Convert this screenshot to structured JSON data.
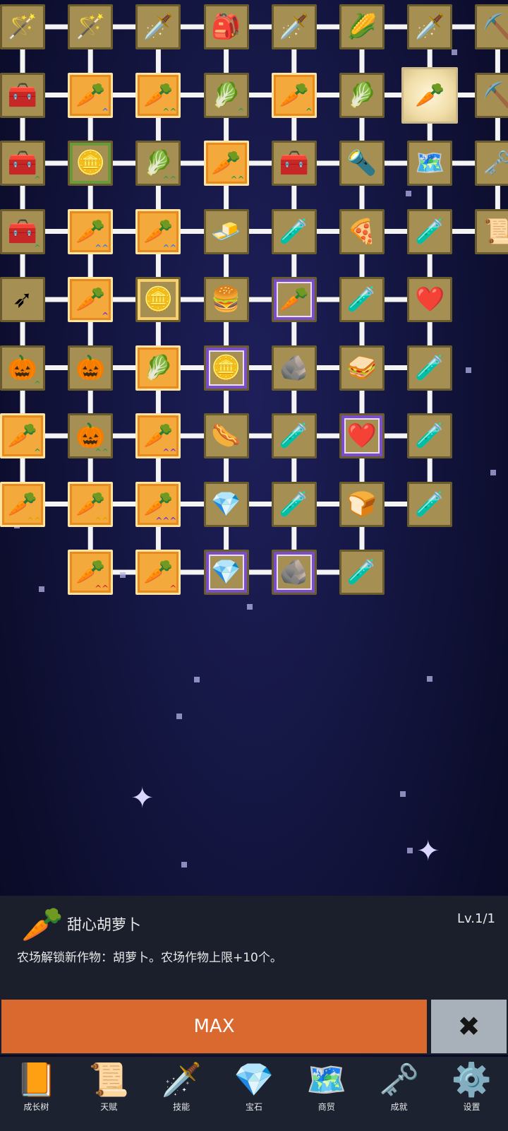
{
  "tree": {
    "rows": [
      [
        {
          "icon": "staff-icon",
          "glyph": "🪄",
          "style": "plain"
        },
        {
          "icon": "magic-wand-icon",
          "glyph": "🪄",
          "style": "plain"
        },
        {
          "icon": "sword-icon",
          "glyph": "🗡️",
          "style": "plain"
        },
        {
          "icon": "backpack-icon",
          "glyph": "🎒",
          "style": "plain"
        },
        {
          "icon": "sword-icon",
          "glyph": "🗡️",
          "style": "plain"
        },
        {
          "icon": "corn-icon",
          "glyph": "🌽",
          "style": "plain"
        },
        {
          "icon": "dagger-icon",
          "glyph": "🗡️",
          "style": "plain"
        },
        {
          "icon": "pickaxe-icon",
          "glyph": "⛏️",
          "style": "plain"
        }
      ],
      [
        {
          "icon": "chest-icon",
          "glyph": "🧰",
          "style": "plain"
        },
        {
          "icon": "carrot-icon",
          "glyph": "🥕",
          "style": "orange",
          "chev": "^",
          "chevColor": "#4a7be0"
        },
        {
          "icon": "carrot-icon",
          "glyph": "🥕",
          "style": "orange",
          "chev": "^^",
          "chevColor": "#3f9b4a"
        },
        {
          "icon": "cabbage-icon",
          "glyph": "🥬",
          "style": "plain",
          "chev": "^",
          "chevColor": "#3f9b4a"
        },
        {
          "icon": "carrot-icon",
          "glyph": "🥕",
          "style": "orange",
          "chev": "^",
          "chevColor": "#3f9b4a"
        },
        {
          "icon": "cabbage-icon",
          "glyph": "🥬",
          "style": "plain"
        },
        {
          "icon": "carrot-icon",
          "glyph": "🥕",
          "style": "selected"
        },
        {
          "icon": "pickaxe-icon",
          "glyph": "⛏️",
          "style": "plain"
        }
      ],
      [
        {
          "icon": "chest-icon",
          "glyph": "🧰",
          "style": "plain",
          "chev": "^",
          "chevColor": "#3f9b4a"
        },
        {
          "icon": "gold-coin-icon",
          "glyph": "🪙",
          "style": "green"
        },
        {
          "icon": "cabbage-icon",
          "glyph": "🥬",
          "style": "plain",
          "chev": "^^",
          "chevColor": "#3f9b4a"
        },
        {
          "icon": "carrot-icon",
          "glyph": "🥕",
          "style": "orange",
          "chev": "^^",
          "chevColor": "#3f9b4a"
        },
        {
          "icon": "treasure-chest-icon",
          "glyph": "🧰",
          "style": "plain"
        },
        {
          "icon": "torch-icon",
          "glyph": "🔦",
          "style": "plain"
        },
        {
          "icon": "map-icon",
          "glyph": "🗺️",
          "style": "plain"
        },
        {
          "icon": "key-icon",
          "glyph": "🗝️",
          "style": "plain"
        }
      ],
      [
        {
          "icon": "chest-icon",
          "glyph": "🧰",
          "style": "plain",
          "chev": "^",
          "chevColor": "#3f9b4a"
        },
        {
          "icon": "carrot-icon",
          "glyph": "🥕",
          "style": "orange",
          "chev": "^^",
          "chevColor": "#4a7be0"
        },
        {
          "icon": "carrot-icon",
          "glyph": "🥕",
          "style": "orange",
          "chev": "^^",
          "chevColor": "#4a7be0"
        },
        {
          "icon": "gold-bar-icon",
          "glyph": "🧈",
          "style": "plain"
        },
        {
          "icon": "yellow-potion-icon",
          "glyph": "🧪",
          "style": "plain"
        },
        {
          "icon": "pizza-icon",
          "glyph": "🍕",
          "style": "plain"
        },
        {
          "icon": "green-potion-icon",
          "glyph": "🧪",
          "style": "plain"
        },
        {
          "icon": "scroll-icon",
          "glyph": "📜",
          "style": "plain"
        }
      ],
      [
        {
          "icon": "arrow-icon",
          "glyph": "➶",
          "style": "plain"
        },
        {
          "icon": "carrot-icon",
          "glyph": "🥕",
          "style": "orange",
          "chev": "^",
          "chevColor": "#7a3fcf"
        },
        {
          "icon": "gold-coin-icon",
          "glyph": "🪙",
          "style": "gold"
        },
        {
          "icon": "burger-icon",
          "glyph": "🍔",
          "style": "plain"
        },
        {
          "icon": "carrot-icon",
          "glyph": "🥕",
          "style": "purple"
        },
        {
          "icon": "yellow-potion-icon",
          "glyph": "🧪",
          "style": "plain"
        },
        {
          "icon": "heart-icon",
          "glyph": "❤️",
          "style": "plain"
        }
      ],
      [
        {
          "icon": "pumpkin-icon",
          "glyph": "🎃",
          "style": "plain",
          "chev": "^",
          "chevColor": "#3f9b4a"
        },
        {
          "icon": "pumpkin-icon",
          "glyph": "🎃",
          "style": "plain"
        },
        {
          "icon": "cabbage-icon",
          "glyph": "🥬",
          "style": "orange"
        },
        {
          "icon": "gold-coin-icon",
          "glyph": "🪙",
          "style": "purple"
        },
        {
          "icon": "fossil-stone-icon",
          "glyph": "🪨",
          "style": "plain"
        },
        {
          "icon": "sandwich-icon",
          "glyph": "🥪",
          "style": "plain"
        },
        {
          "icon": "red-potion-icon",
          "glyph": "🧪",
          "style": "plain"
        }
      ],
      [
        {
          "icon": "carrot-icon",
          "glyph": "🥕",
          "style": "orange",
          "chev": "^",
          "chevColor": "#3f9b4a"
        },
        {
          "icon": "pumpkin-icon",
          "glyph": "🎃",
          "style": "plain",
          "chev": "^^",
          "chevColor": "#3f9b4a"
        },
        {
          "icon": "carrot-icon",
          "glyph": "🥕",
          "style": "orange",
          "chev": "^^",
          "chevColor": "#7a3fcf"
        },
        {
          "icon": "hotdog-icon",
          "glyph": "🌭",
          "style": "plain"
        },
        {
          "icon": "red-potion-icon",
          "glyph": "🧪",
          "style": "plain"
        },
        {
          "icon": "heart-icon",
          "glyph": "❤️",
          "style": "purple"
        },
        {
          "icon": "gray-potion-icon",
          "glyph": "🧪",
          "style": "plain"
        }
      ],
      [
        {
          "icon": "carrot-icon",
          "glyph": "🥕",
          "style": "orange",
          "chev": "^^",
          "chevColor": "#e0a500"
        },
        {
          "icon": "carrot-icon",
          "glyph": "🥕",
          "style": "orange",
          "chev": "^^",
          "chevColor": "#e0a500"
        },
        {
          "icon": "carrot-icon",
          "glyph": "🥕",
          "style": "orange",
          "chev": "^^^",
          "chevColor": "#7a3fcf"
        },
        {
          "icon": "crystal-icon",
          "glyph": "💎",
          "style": "plain"
        },
        {
          "icon": "black-potion-icon",
          "glyph": "🧪",
          "style": "plain"
        },
        {
          "icon": "bread-icon",
          "glyph": "🍞",
          "style": "plain"
        },
        {
          "icon": "blue-potion-icon",
          "glyph": "🧪",
          "style": "plain"
        }
      ],
      [
        null,
        {
          "icon": "carrot-icon",
          "glyph": "🥕",
          "style": "orange",
          "chev": "^^",
          "chevColor": "#d23b3b"
        },
        {
          "icon": "carrot-icon",
          "glyph": "🥕",
          "style": "orange",
          "chev": "^",
          "chevColor": "#d23b3b"
        },
        {
          "icon": "crystal-icon",
          "glyph": "💎",
          "style": "purple"
        },
        {
          "icon": "fossil-stone-icon",
          "glyph": "🪨",
          "style": "purple"
        },
        {
          "icon": "blue-potion-icon",
          "glyph": "🧪",
          "style": "plain"
        }
      ]
    ]
  },
  "detail": {
    "icon": "carrot-icon",
    "icon_glyph": "🥕",
    "title": "甜心胡萝卜",
    "level": "Lv.1/1",
    "description": "农场解锁新作物：胡萝卜。农场作物上限+10个。"
  },
  "actions": {
    "max_label": "MAX",
    "close_glyph": "✖"
  },
  "nav": [
    {
      "label": "成长树",
      "icon": "book-icon",
      "glyph": "📙"
    },
    {
      "label": "天赋",
      "icon": "scroll-icon",
      "glyph": "📜"
    },
    {
      "label": "技能",
      "icon": "sword-icon",
      "glyph": "🗡️"
    },
    {
      "label": "宝石",
      "icon": "crystal-icon",
      "glyph": "💎"
    },
    {
      "label": "商贸",
      "icon": "map-icon",
      "glyph": "🗺️"
    },
    {
      "label": "成就",
      "icon": "key-icon",
      "glyph": "🗝️"
    },
    {
      "label": "设置",
      "icon": "gear-icon",
      "glyph": "⚙️"
    }
  ],
  "colors": {
    "tile": "#a58f52",
    "tile_orange": "#f4a93c",
    "max_button": "#d9692e",
    "close_button": "#a8b0b9",
    "panel": "#1a1f2b"
  }
}
